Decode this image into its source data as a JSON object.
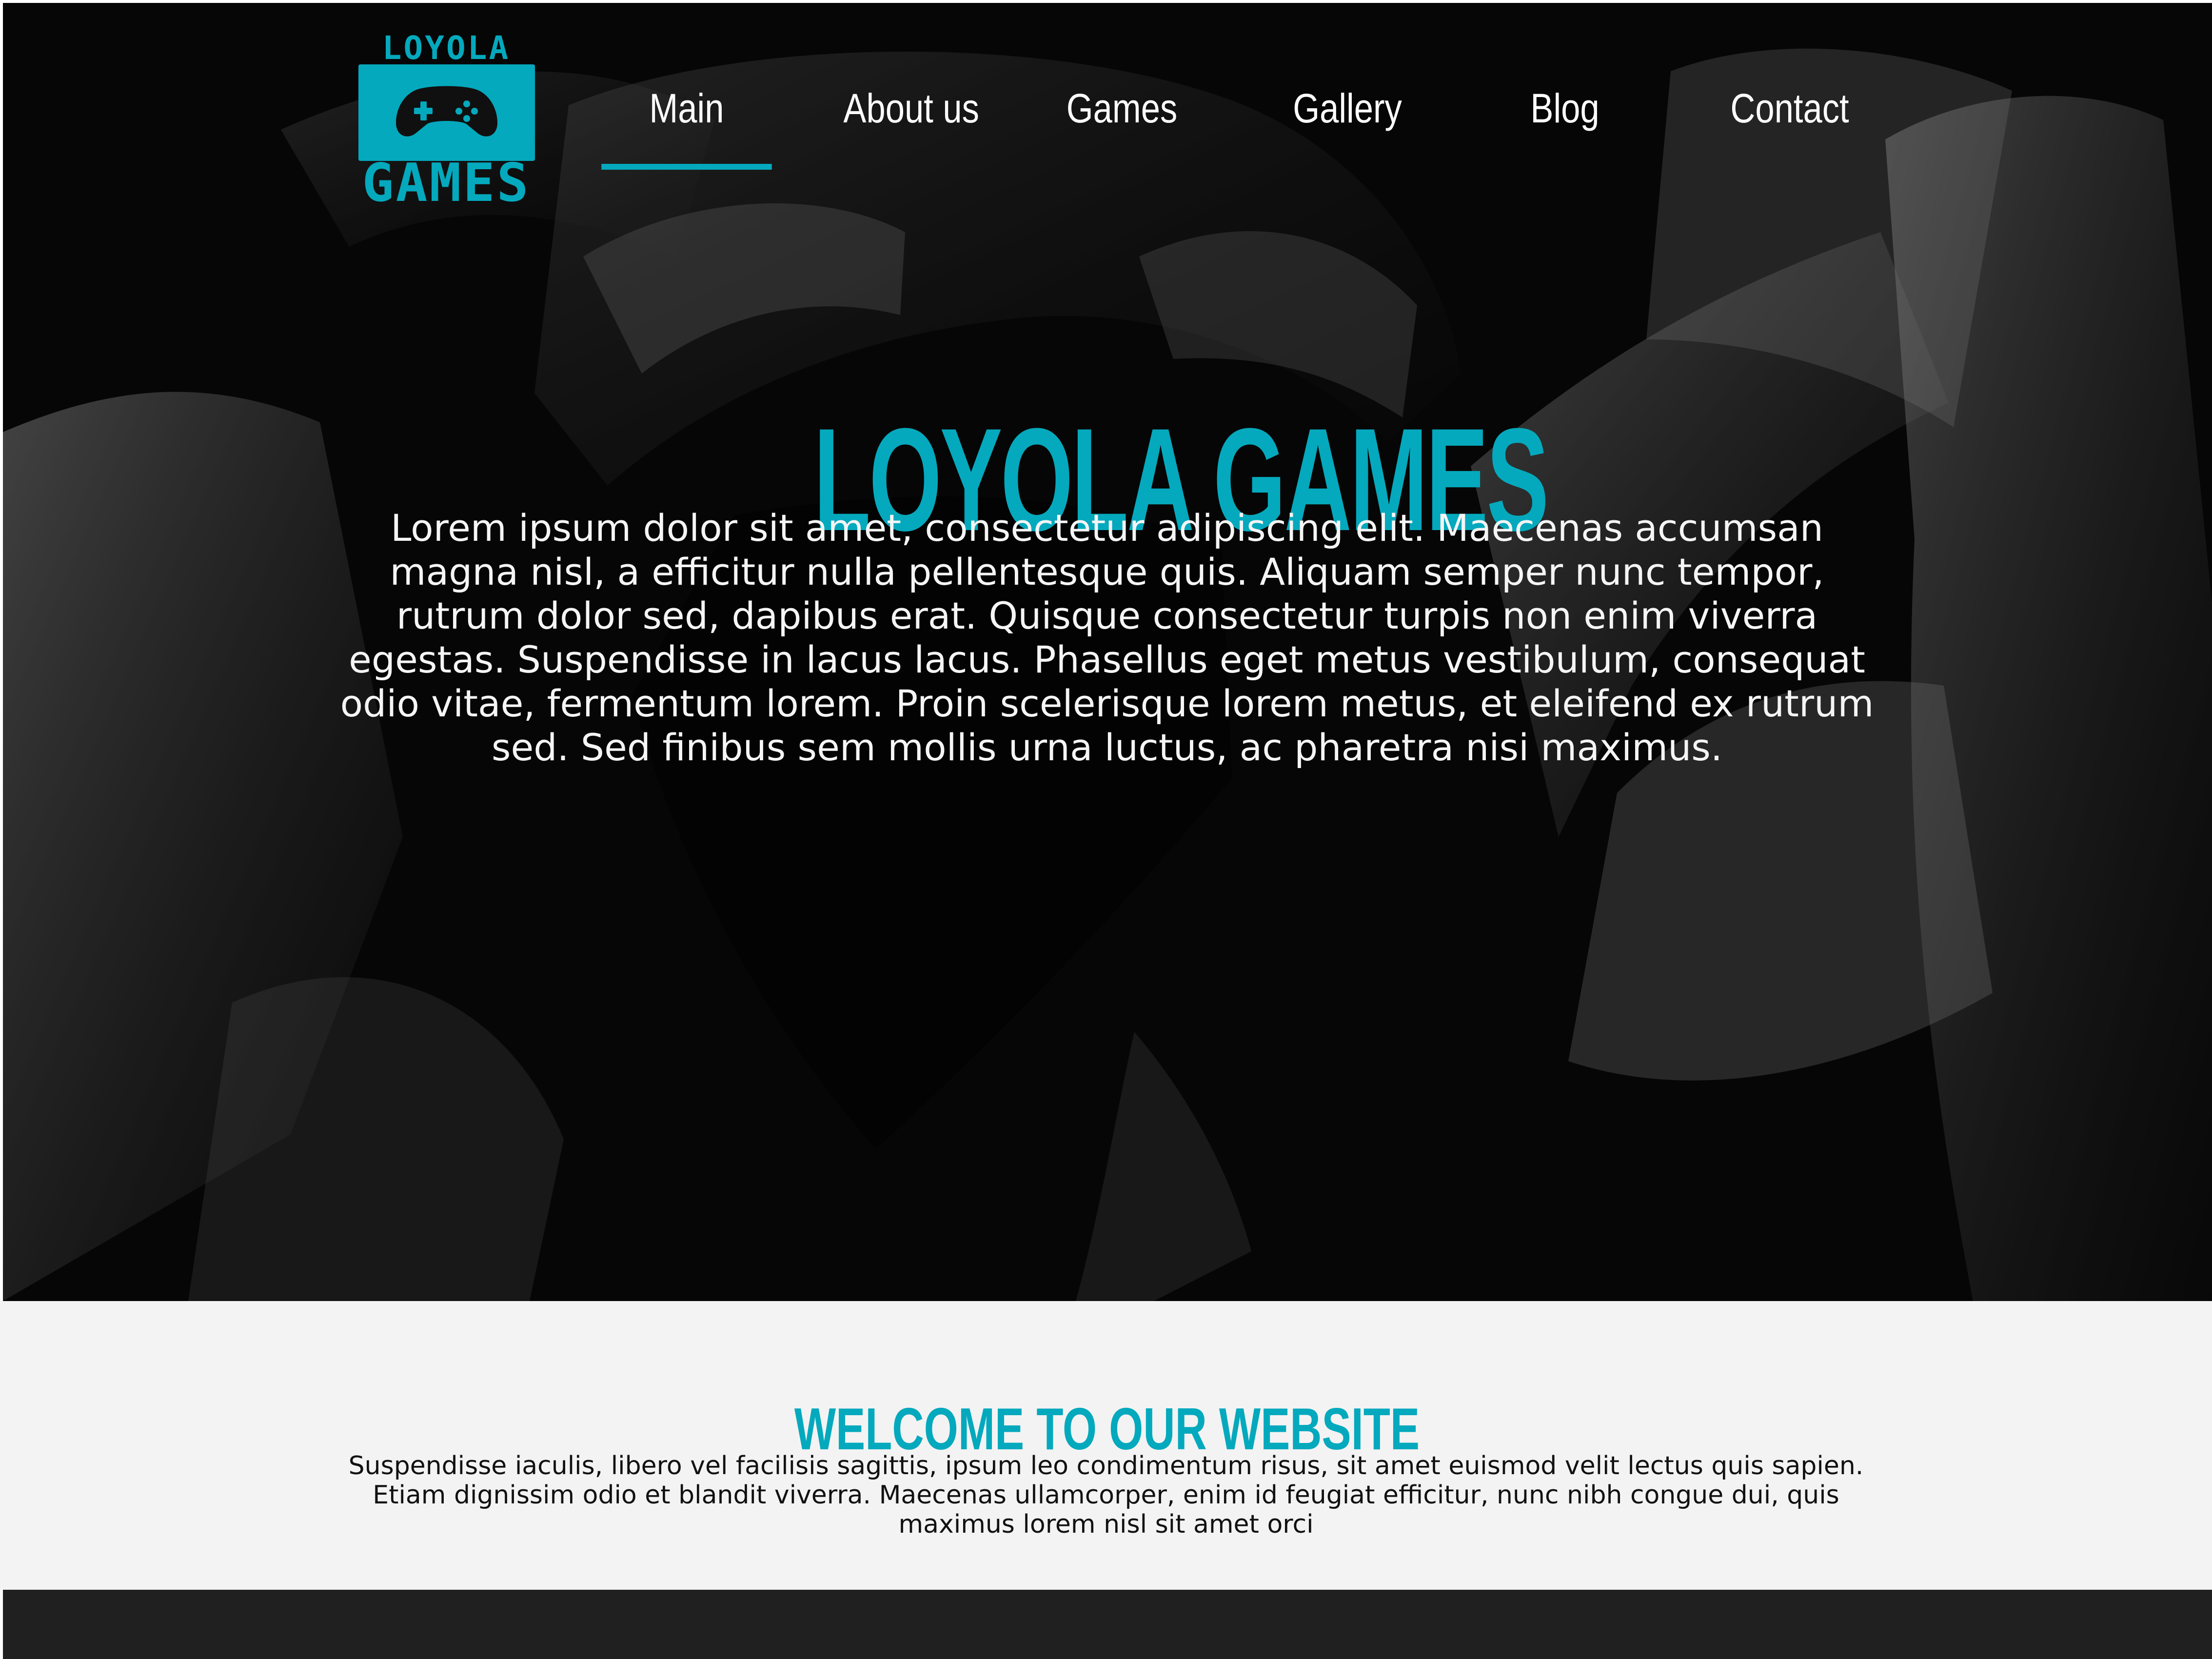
{
  "theme": {
    "accent": "#04a9bd",
    "footer": "#202020"
  },
  "logo": {
    "top": "LOYOLA",
    "bottom": "GAMES"
  },
  "nav": {
    "items": [
      {
        "label": "Main",
        "active": true
      },
      {
        "label": "About us",
        "active": false
      },
      {
        "label": "Games",
        "active": false
      },
      {
        "label": "Gallery",
        "active": false
      },
      {
        "label": "Blog",
        "active": false
      },
      {
        "label": "Contact",
        "active": false
      }
    ]
  },
  "hero": {
    "title": "LOYOLA GAMES",
    "text": "Lorem ipsum dolor sit amet, consectetur adipiscing elit. Maecenas accumsan magna nisl, a efficitur nulla pellentesque quis. Aliquam semper nunc tempor, rutrum dolor sed, dapibus erat. Quisque consectetur turpis non enim viverra egestas. Suspendisse in lacus lacus. Phasellus eget metus vestibulum, consequat odio vitae, fermentum lorem. Proin scelerisque lorem metus, et eleifend ex rutrum sed. Sed finibus sem mollis urna luctus, ac pharetra nisi maximus."
  },
  "welcome": {
    "title": "WELCOME TO OUR WEBSITE",
    "text": "Suspendisse iaculis, libero vel facilisis sagittis, ipsum leo condimentum risus, sit amet euismod velit lectus quis sapien. Etiam dignissim odio et blandit viverra. Maecenas ullamcorper, enim id feugiat efficitur, nunc nibh congue dui, quis maximus lorem nisl sit amet orci"
  },
  "icons": {
    "logo": "game-controller-icon"
  }
}
